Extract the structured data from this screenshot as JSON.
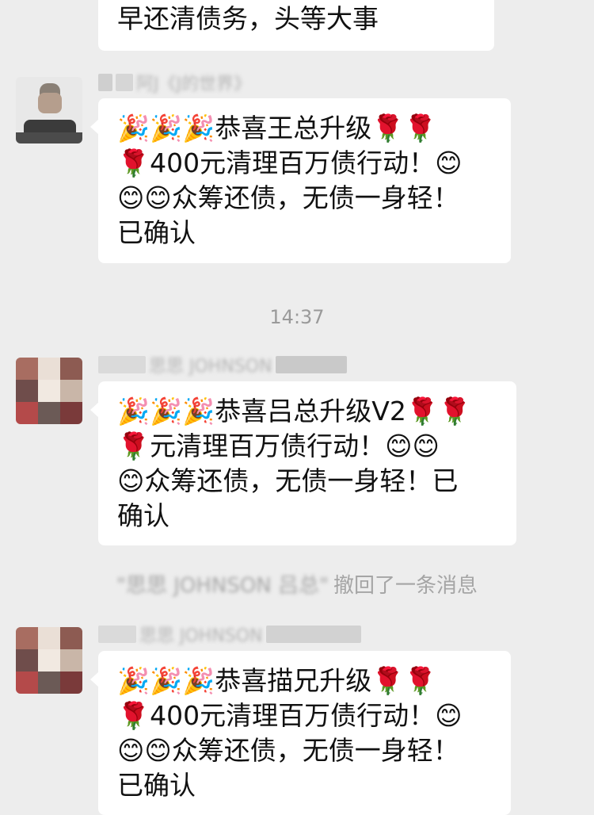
{
  "top_message": {
    "text": "早还清债务，头等大事"
  },
  "messages": [
    {
      "sender_name": "阿J《J的世界》",
      "lines": [
        "🎉🎉🎉恭喜王总升级🌹🌹",
        "🌹400元清理百万债行动！😊",
        "😊😊众筹还债，无债一身轻！",
        "已确认"
      ]
    },
    {
      "sender_name": "思思 JOHNSON",
      "lines": [
        "🎉🎉🎉恭喜吕总升级V2🌹🌹",
        "🌹元清理百万债行动！😊😊",
        "😊众筹还债，无债一身轻！已",
        "确认"
      ]
    },
    {
      "sender_name": "思思 JOHNSON",
      "lines": [
        "🎉🎉🎉恭喜描兄升级🌹🌹",
        "🌹400元清理百万债行动！😊",
        "😊😊众筹还债，无债一身轻！",
        "已确认"
      ]
    }
  ],
  "timestamp": "14:37",
  "recall_notice": {
    "quoted_name": "\"思思 JOHNSON 吕总\"",
    "suffix": "撤回了一条消息"
  }
}
